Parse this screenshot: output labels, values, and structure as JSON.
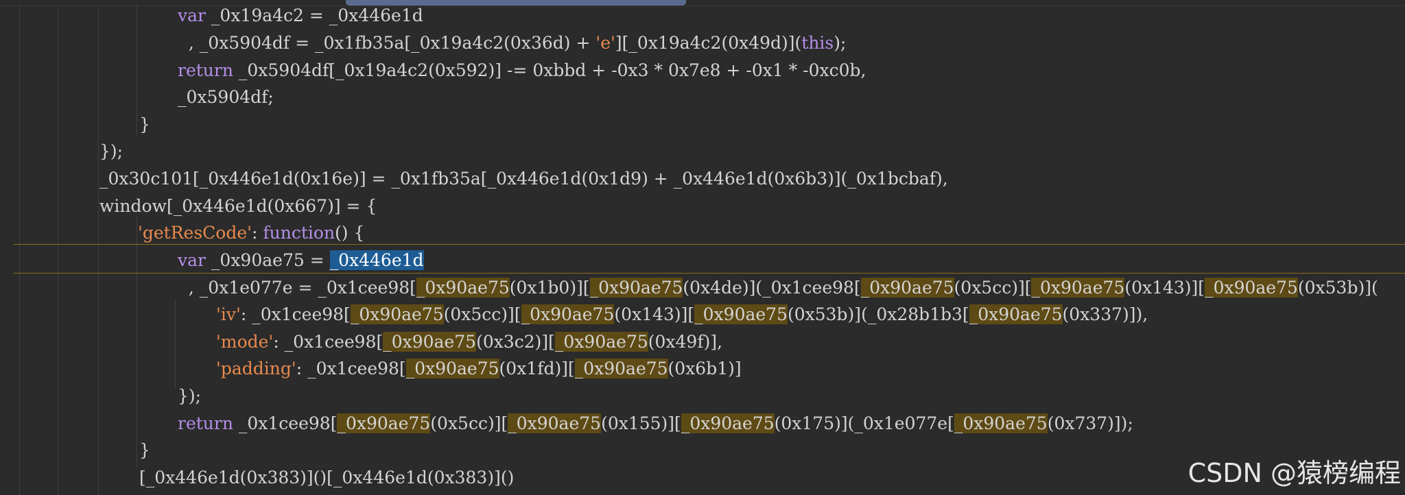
{
  "editor": {
    "lines": [
      [
        {
          "t": "var",
          "c": "kw"
        },
        {
          "t": " _0x19a4c2 = _0x446e1d"
        }
      ],
      [
        {
          "t": "  , _0x5904df = _0x1fb35a[_0x19a4c2(0x36d) + "
        },
        {
          "t": "'e'",
          "c": "str"
        },
        {
          "t": "][_0x19a4c2(0x49d)]("
        },
        {
          "t": "this",
          "c": "kw"
        },
        {
          "t": ");"
        }
      ],
      [
        {
          "t": "return",
          "c": "kw"
        },
        {
          "t": " _0x5904df[_0x19a4c2(0x592)] -= 0xbbd + -0x3 * 0x7e8 + -0x1 * -0xc0b,"
        }
      ],
      [
        {
          "t": "_0x5904df;"
        }
      ],
      [
        {
          "t": "}"
        }
      ],
      [
        {
          "t": "});"
        }
      ],
      [
        {
          "t": "_0x30c101[_0x446e1d(0x16e)] = _0x1fb35a[_0x446e1d(0x1d9) + _0x446e1d(0x6b3)](_0x1bcbaf),"
        }
      ],
      [
        {
          "t": "window[_0x446e1d(0x667)] = {"
        }
      ],
      [
        {
          "t": "'getResCode'",
          "c": "str"
        },
        {
          "t": ": "
        },
        {
          "t": "function",
          "c": "kw"
        },
        {
          "t": "() {"
        }
      ],
      [
        {
          "t": "var",
          "c": "kw"
        },
        {
          "t": " _0x90ae75 = "
        },
        {
          "t": "_0x446e1d",
          "c": "sel"
        }
      ],
      [
        {
          "t": "  , _0x1e077e = _0x1cee98["
        },
        {
          "t": "_0x90ae75",
          "c": "hl"
        },
        {
          "t": "(0x1b0)]["
        },
        {
          "t": "_0x90ae75",
          "c": "hl"
        },
        {
          "t": "(0x4de)](_0x1cee98["
        },
        {
          "t": "_0x90ae75",
          "c": "hl"
        },
        {
          "t": "(0x5cc)]["
        },
        {
          "t": "_0x90ae75",
          "c": "hl"
        },
        {
          "t": "(0x143)]["
        },
        {
          "t": "_0x90ae75",
          "c": "hl"
        },
        {
          "t": "(0x53b)]("
        }
      ],
      [
        {
          "t": "'iv'",
          "c": "str"
        },
        {
          "t": ": _0x1cee98["
        },
        {
          "t": "_0x90ae75",
          "c": "hl"
        },
        {
          "t": "(0x5cc)]["
        },
        {
          "t": "_0x90ae75",
          "c": "hl"
        },
        {
          "t": "(0x143)]["
        },
        {
          "t": "_0x90ae75",
          "c": "hl"
        },
        {
          "t": "(0x53b)](_0x28b1b3["
        },
        {
          "t": "_0x90ae75",
          "c": "hl"
        },
        {
          "t": "(0x337)]),"
        }
      ],
      [
        {
          "t": "'mode'",
          "c": "str"
        },
        {
          "t": ": _0x1cee98["
        },
        {
          "t": "_0x90ae75",
          "c": "hl"
        },
        {
          "t": "(0x3c2)]["
        },
        {
          "t": "_0x90ae75",
          "c": "hl"
        },
        {
          "t": "(0x49f)],"
        }
      ],
      [
        {
          "t": "'padding'",
          "c": "str"
        },
        {
          "t": ": _0x1cee98["
        },
        {
          "t": "_0x90ae75",
          "c": "hl"
        },
        {
          "t": "(0x1fd)]["
        },
        {
          "t": "_0x90ae75",
          "c": "hl"
        },
        {
          "t": "(0x6b1)]"
        }
      ],
      [
        {
          "t": "});"
        }
      ],
      [
        {
          "t": "return",
          "c": "kw"
        },
        {
          "t": " _0x1cee98["
        },
        {
          "t": "_0x90ae75",
          "c": "hl"
        },
        {
          "t": "(0x5cc)]["
        },
        {
          "t": "_0x90ae75",
          "c": "hl"
        },
        {
          "t": "(0x155)]["
        },
        {
          "t": "_0x90ae75",
          "c": "hl"
        },
        {
          "t": "(0x175)](_0x1e077e["
        },
        {
          "t": "_0x90ae75",
          "c": "hl"
        },
        {
          "t": "(0x737)]);"
        }
      ],
      [
        {
          "t": "}"
        }
      ],
      [
        {
          "t": "[_0x446e1d(0x383)]()[_0x446e1d(0x383)]()"
        }
      ]
    ]
  },
  "watermark": "CSDN @猿榜编程"
}
